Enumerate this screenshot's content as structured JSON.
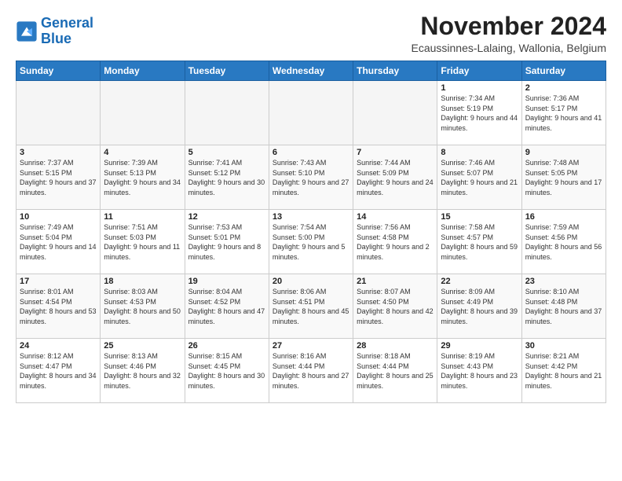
{
  "header": {
    "logo_line1": "General",
    "logo_line2": "Blue",
    "month": "November 2024",
    "location": "Ecaussinnes-Lalaing, Wallonia, Belgium"
  },
  "weekdays": [
    "Sunday",
    "Monday",
    "Tuesday",
    "Wednesday",
    "Thursday",
    "Friday",
    "Saturday"
  ],
  "weeks": [
    [
      {
        "day": "",
        "info": ""
      },
      {
        "day": "",
        "info": ""
      },
      {
        "day": "",
        "info": ""
      },
      {
        "day": "",
        "info": ""
      },
      {
        "day": "",
        "info": ""
      },
      {
        "day": "1",
        "info": "Sunrise: 7:34 AM\nSunset: 5:19 PM\nDaylight: 9 hours and 44 minutes."
      },
      {
        "day": "2",
        "info": "Sunrise: 7:36 AM\nSunset: 5:17 PM\nDaylight: 9 hours and 41 minutes."
      }
    ],
    [
      {
        "day": "3",
        "info": "Sunrise: 7:37 AM\nSunset: 5:15 PM\nDaylight: 9 hours and 37 minutes."
      },
      {
        "day": "4",
        "info": "Sunrise: 7:39 AM\nSunset: 5:13 PM\nDaylight: 9 hours and 34 minutes."
      },
      {
        "day": "5",
        "info": "Sunrise: 7:41 AM\nSunset: 5:12 PM\nDaylight: 9 hours and 30 minutes."
      },
      {
        "day": "6",
        "info": "Sunrise: 7:43 AM\nSunset: 5:10 PM\nDaylight: 9 hours and 27 minutes."
      },
      {
        "day": "7",
        "info": "Sunrise: 7:44 AM\nSunset: 5:09 PM\nDaylight: 9 hours and 24 minutes."
      },
      {
        "day": "8",
        "info": "Sunrise: 7:46 AM\nSunset: 5:07 PM\nDaylight: 9 hours and 21 minutes."
      },
      {
        "day": "9",
        "info": "Sunrise: 7:48 AM\nSunset: 5:05 PM\nDaylight: 9 hours and 17 minutes."
      }
    ],
    [
      {
        "day": "10",
        "info": "Sunrise: 7:49 AM\nSunset: 5:04 PM\nDaylight: 9 hours and 14 minutes."
      },
      {
        "day": "11",
        "info": "Sunrise: 7:51 AM\nSunset: 5:03 PM\nDaylight: 9 hours and 11 minutes."
      },
      {
        "day": "12",
        "info": "Sunrise: 7:53 AM\nSunset: 5:01 PM\nDaylight: 9 hours and 8 minutes."
      },
      {
        "day": "13",
        "info": "Sunrise: 7:54 AM\nSunset: 5:00 PM\nDaylight: 9 hours and 5 minutes."
      },
      {
        "day": "14",
        "info": "Sunrise: 7:56 AM\nSunset: 4:58 PM\nDaylight: 9 hours and 2 minutes."
      },
      {
        "day": "15",
        "info": "Sunrise: 7:58 AM\nSunset: 4:57 PM\nDaylight: 8 hours and 59 minutes."
      },
      {
        "day": "16",
        "info": "Sunrise: 7:59 AM\nSunset: 4:56 PM\nDaylight: 8 hours and 56 minutes."
      }
    ],
    [
      {
        "day": "17",
        "info": "Sunrise: 8:01 AM\nSunset: 4:54 PM\nDaylight: 8 hours and 53 minutes."
      },
      {
        "day": "18",
        "info": "Sunrise: 8:03 AM\nSunset: 4:53 PM\nDaylight: 8 hours and 50 minutes."
      },
      {
        "day": "19",
        "info": "Sunrise: 8:04 AM\nSunset: 4:52 PM\nDaylight: 8 hours and 47 minutes."
      },
      {
        "day": "20",
        "info": "Sunrise: 8:06 AM\nSunset: 4:51 PM\nDaylight: 8 hours and 45 minutes."
      },
      {
        "day": "21",
        "info": "Sunrise: 8:07 AM\nSunset: 4:50 PM\nDaylight: 8 hours and 42 minutes."
      },
      {
        "day": "22",
        "info": "Sunrise: 8:09 AM\nSunset: 4:49 PM\nDaylight: 8 hours and 39 minutes."
      },
      {
        "day": "23",
        "info": "Sunrise: 8:10 AM\nSunset: 4:48 PM\nDaylight: 8 hours and 37 minutes."
      }
    ],
    [
      {
        "day": "24",
        "info": "Sunrise: 8:12 AM\nSunset: 4:47 PM\nDaylight: 8 hours and 34 minutes."
      },
      {
        "day": "25",
        "info": "Sunrise: 8:13 AM\nSunset: 4:46 PM\nDaylight: 8 hours and 32 minutes."
      },
      {
        "day": "26",
        "info": "Sunrise: 8:15 AM\nSunset: 4:45 PM\nDaylight: 8 hours and 30 minutes."
      },
      {
        "day": "27",
        "info": "Sunrise: 8:16 AM\nSunset: 4:44 PM\nDaylight: 8 hours and 27 minutes."
      },
      {
        "day": "28",
        "info": "Sunrise: 8:18 AM\nSunset: 4:44 PM\nDaylight: 8 hours and 25 minutes."
      },
      {
        "day": "29",
        "info": "Sunrise: 8:19 AM\nSunset: 4:43 PM\nDaylight: 8 hours and 23 minutes."
      },
      {
        "day": "30",
        "info": "Sunrise: 8:21 AM\nSunset: 4:42 PM\nDaylight: 8 hours and 21 minutes."
      }
    ]
  ]
}
